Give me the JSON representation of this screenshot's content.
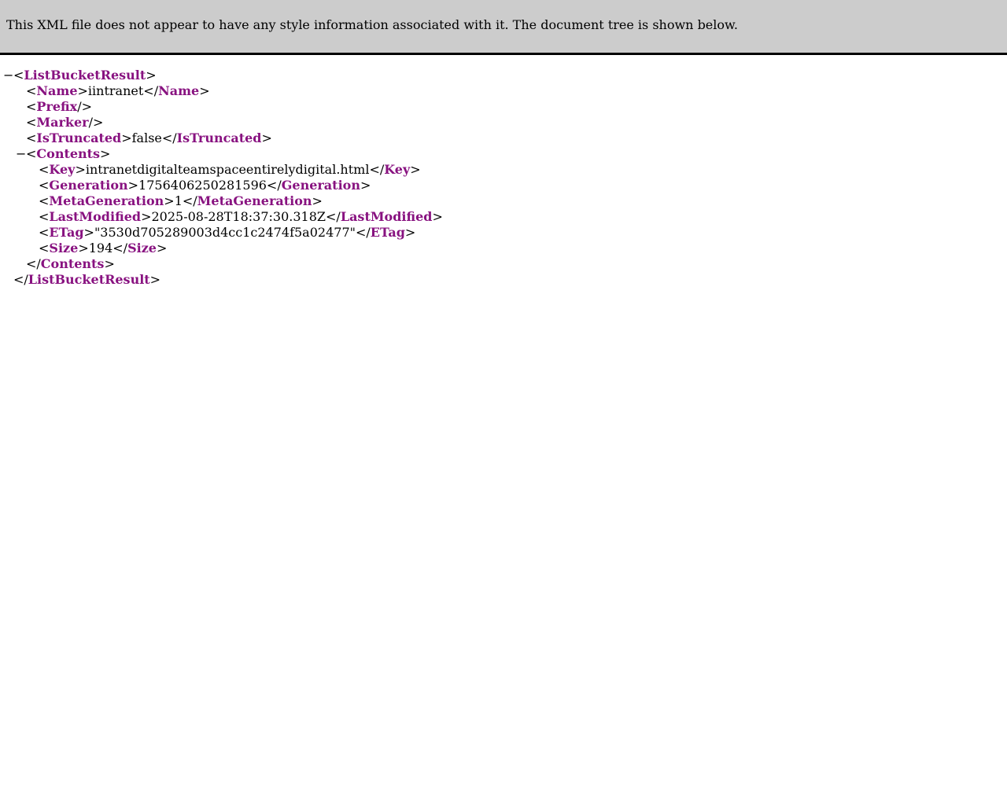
{
  "header": {
    "message": "This XML file does not appear to have any style information associated with it. The document tree is shown below."
  },
  "tree": {
    "collapse_symbol": "−",
    "root": "ListBucketResult",
    "name": {
      "tag": "Name",
      "value": "iintranet"
    },
    "prefix": {
      "tag": "Prefix"
    },
    "marker": {
      "tag": "Marker"
    },
    "is_truncated": {
      "tag": "IsTruncated",
      "value": "false"
    },
    "contents": {
      "tag": "Contents",
      "key": {
        "tag": "Key",
        "value": "intranetdigitalteamspaceentirelydigital.html"
      },
      "generation": {
        "tag": "Generation",
        "value": "1756406250281596"
      },
      "meta_generation": {
        "tag": "MetaGeneration",
        "value": "1"
      },
      "last_modified": {
        "tag": "LastModified",
        "value": "2025-08-28T18:37:30.318Z"
      },
      "etag": {
        "tag": "ETag",
        "value": "\"3530d705289003d4cc1c2474f5a02477\""
      },
      "size": {
        "tag": "Size",
        "value": "194"
      }
    }
  }
}
